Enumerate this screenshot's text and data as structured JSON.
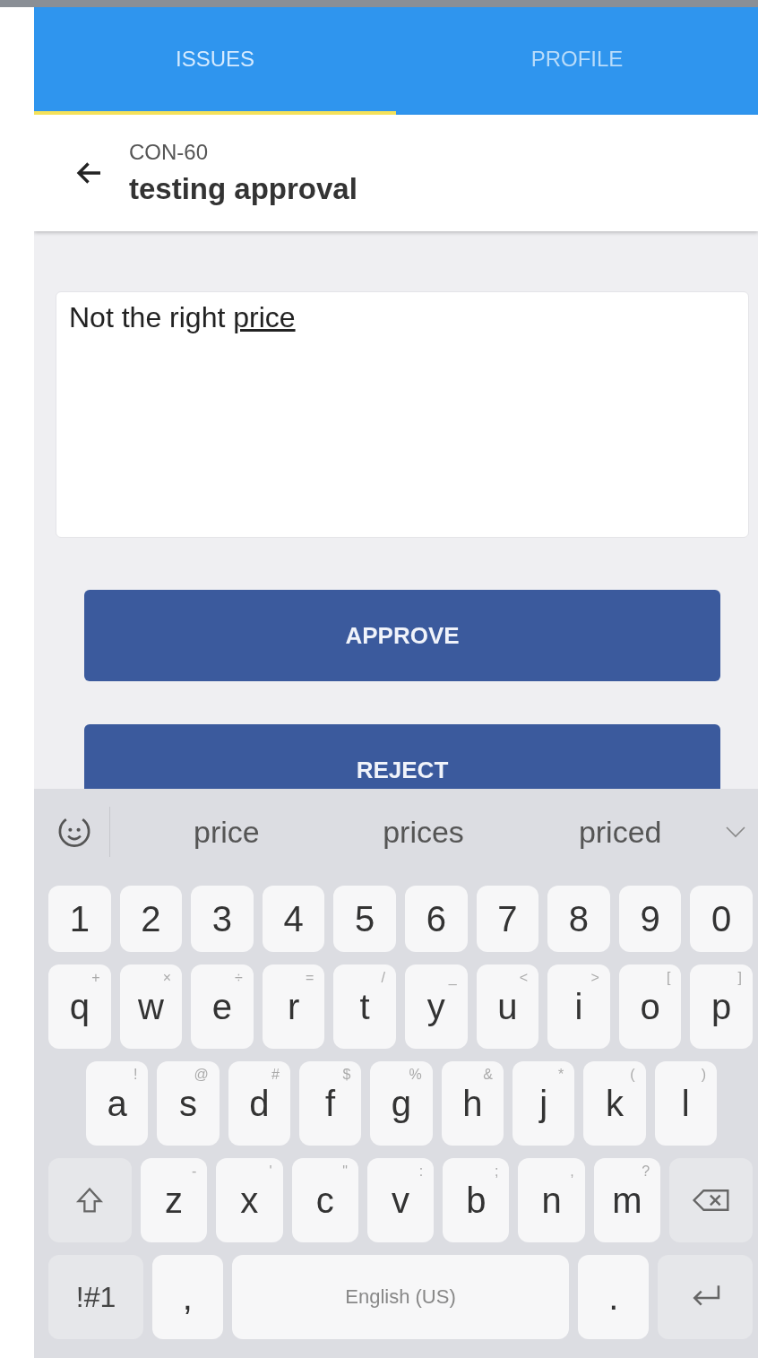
{
  "tabs": [
    {
      "label": "ISSUES",
      "selected": true
    },
    {
      "label": "PROFILE",
      "selected": false
    }
  ],
  "header": {
    "key": "CON-60",
    "title": "testing approval"
  },
  "comment": {
    "value": "Not the right ",
    "composing": "price"
  },
  "buttons": [
    {
      "label": "APPROVE"
    },
    {
      "label": "REJECT"
    }
  ],
  "keyboard": {
    "suggestions": [
      "price",
      "prices",
      "priced"
    ],
    "rows": [
      [
        {
          "kind": "char",
          "label": "1"
        },
        {
          "kind": "char",
          "label": "2"
        },
        {
          "kind": "char",
          "label": "3"
        },
        {
          "kind": "char",
          "label": "4"
        },
        {
          "kind": "char",
          "label": "5"
        },
        {
          "kind": "char",
          "label": "6"
        },
        {
          "kind": "char",
          "label": "7"
        },
        {
          "kind": "char",
          "label": "8"
        },
        {
          "kind": "char",
          "label": "9"
        },
        {
          "kind": "char",
          "label": "0"
        }
      ],
      [
        {
          "kind": "char",
          "label": "q",
          "hint": "+"
        },
        {
          "kind": "char",
          "label": "w",
          "hint": "×"
        },
        {
          "kind": "char",
          "label": "e",
          "hint": "÷"
        },
        {
          "kind": "char",
          "label": "r",
          "hint": "="
        },
        {
          "kind": "char",
          "label": "t",
          "hint": "/"
        },
        {
          "kind": "char",
          "label": "y",
          "hint": "_"
        },
        {
          "kind": "char",
          "label": "u",
          "hint": "<"
        },
        {
          "kind": "char",
          "label": "i",
          "hint": ">"
        },
        {
          "kind": "char",
          "label": "o",
          "hint": "["
        },
        {
          "kind": "char",
          "label": "p",
          "hint": "]"
        }
      ],
      [
        {
          "kind": "char",
          "label": "a",
          "hint": "!"
        },
        {
          "kind": "char",
          "label": "s",
          "hint": "@"
        },
        {
          "kind": "char",
          "label": "d",
          "hint": "#"
        },
        {
          "kind": "char",
          "label": "f",
          "hint": "$"
        },
        {
          "kind": "char",
          "label": "g",
          "hint": "%"
        },
        {
          "kind": "char",
          "label": "h",
          "hint": "&"
        },
        {
          "kind": "char",
          "label": "j",
          "hint": "*"
        },
        {
          "kind": "char",
          "label": "k",
          "hint": "("
        },
        {
          "kind": "char",
          "label": "l",
          "hint": ")"
        }
      ],
      [
        {
          "kind": "shift"
        },
        {
          "kind": "char",
          "label": "z",
          "hint": "-"
        },
        {
          "kind": "char",
          "label": "x",
          "hint": "'"
        },
        {
          "kind": "char",
          "label": "c",
          "hint": "\""
        },
        {
          "kind": "char",
          "label": "v",
          "hint": ":"
        },
        {
          "kind": "char",
          "label": "b",
          "hint": ";"
        },
        {
          "kind": "char",
          "label": "n",
          "hint": ","
        },
        {
          "kind": "char",
          "label": "m",
          "hint": "?"
        },
        {
          "kind": "backspace"
        }
      ]
    ],
    "bottom_row": [
      {
        "kind": "symbols",
        "label": "!#1"
      },
      {
        "kind": "char",
        "label": ","
      },
      {
        "kind": "space",
        "label": "English (US)"
      },
      {
        "kind": "char",
        "label": "."
      },
      {
        "kind": "enter"
      }
    ]
  }
}
